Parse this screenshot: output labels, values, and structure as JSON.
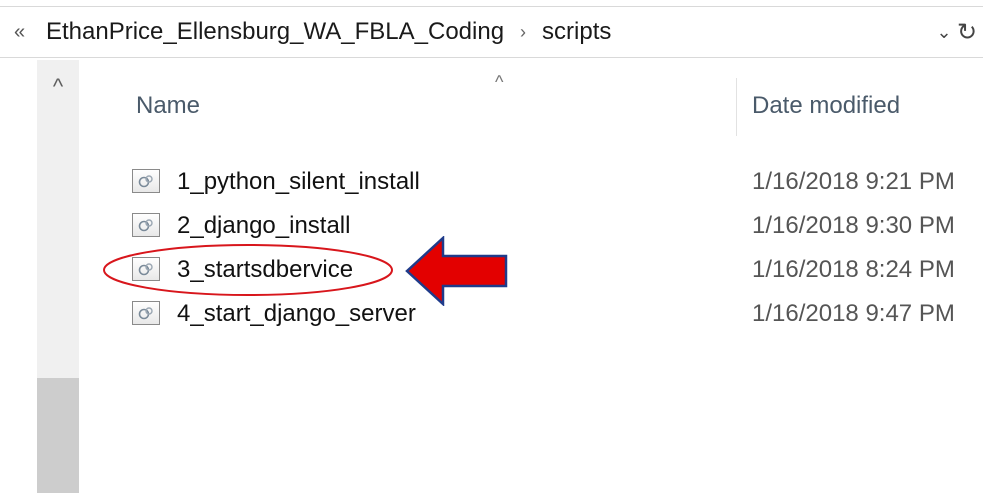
{
  "address_bar": {
    "overflow_glyph": "«",
    "crumbs": [
      "EthanPrice_Ellensburg_WA_FBLA_Coding",
      "scripts"
    ],
    "separator": "›",
    "dropdown_glyph": "⌄",
    "refresh_glyph": "↻"
  },
  "scrollbar": {
    "up_glyph": "^"
  },
  "columns": {
    "sort_glyph": "^",
    "name": "Name",
    "date_modified": "Date modified"
  },
  "files": [
    {
      "name": "1_python_silent_install",
      "date": "1/16/2018 9:21 PM",
      "icon": "script-file-icon"
    },
    {
      "name": "2_django_install",
      "date": "1/16/2018 9:30 PM",
      "icon": "script-file-icon"
    },
    {
      "name": "3_startsdbervice",
      "date": "1/16/2018 8:24 PM",
      "icon": "script-file-icon"
    },
    {
      "name": "4_start_django_server",
      "date": "1/16/2018 9:47 PM",
      "icon": "script-file-icon"
    }
  ],
  "colors": {
    "annotation_red": "#e30000",
    "annotation_circle": "#d8161c"
  }
}
